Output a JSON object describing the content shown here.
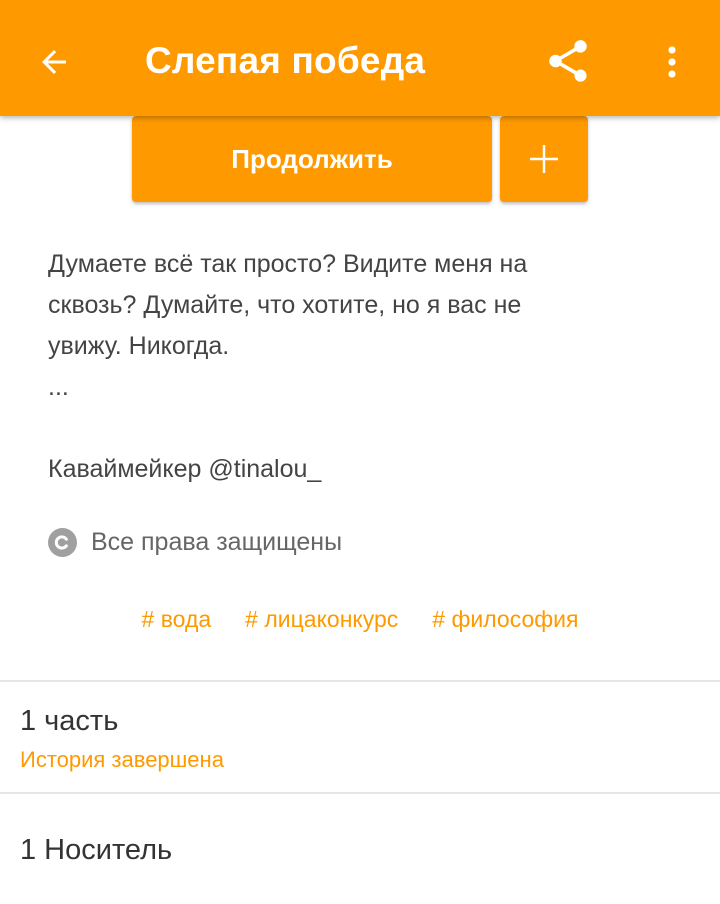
{
  "appbar": {
    "title": "Слепая победа",
    "back_icon": "arrow-left-icon",
    "share_icon": "share-icon",
    "more_icon": "more-vertical-icon",
    "color": "#ff9900"
  },
  "actions": {
    "continue_label": "Продолжить",
    "add_icon": "plus-icon"
  },
  "description": {
    "lines": [
      "Думаете всё так просто? Видите меня на",
      "сквозь? Думайте, что хотите, но я вас не",
      "увижу. Никогда.",
      "..."
    ],
    "author_line": "Каваймейкер @tinalou_"
  },
  "copyright": {
    "icon": "copyright-icon",
    "text": "Все права защищены"
  },
  "tags": [
    "# вода",
    "# лицаконкурс",
    "# философия"
  ],
  "parts": {
    "title": "1 часть",
    "status": "История завершена"
  },
  "media": {
    "title": "1 Носитель"
  }
}
